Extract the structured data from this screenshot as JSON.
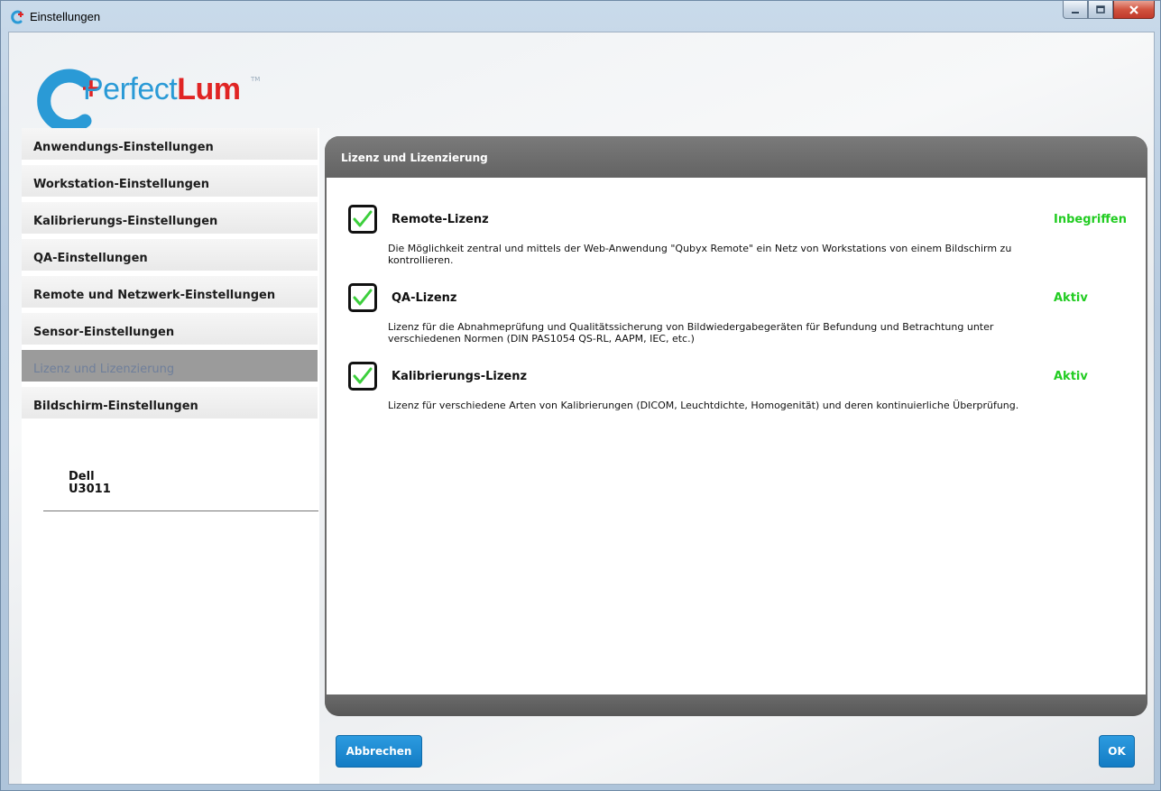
{
  "window": {
    "title": "Einstellungen"
  },
  "logo": {
    "name_prefix": "Perfect",
    "name_suffix": "Lum",
    "tm": "TM"
  },
  "sidebar": {
    "items": [
      {
        "label": "Anwendungs-Einstellungen",
        "active": false
      },
      {
        "label": "Workstation-Einstellungen",
        "active": false
      },
      {
        "label": "Kalibrierungs-Einstellungen",
        "active": false
      },
      {
        "label": "QA-Einstellungen",
        "active": false
      },
      {
        "label": "Remote und Netzwerk-Einstellungen",
        "active": false
      },
      {
        "label": "Sensor-Einstellungen",
        "active": false
      },
      {
        "label": "Lizenz und Lizenzierung",
        "active": true
      },
      {
        "label": "Bildschirm-Einstellungen",
        "active": false
      }
    ],
    "monitor": {
      "vendor": "Dell",
      "model": "U3011"
    }
  },
  "panel": {
    "title": "Lizenz und Lizenzierung",
    "licenses": [
      {
        "name": "Remote-Lizenz",
        "status": "Inbegriffen",
        "checked": true,
        "description": "Die Möglichkeit zentral und mittels der Web-Anwendung \"Qubyx Remote\" ein Netz von Workstations von einem Bildschirm zu kontrollieren."
      },
      {
        "name": "QA-Lizenz",
        "status": "Aktiv",
        "checked": true,
        "description": "Lizenz für die Abnahmeprüfung und Qualitätssicherung von Bildwiedergabegeräten für Befundung und Betrachtung unter verschiedenen Normen (DIN PAS1054 QS-RL, AAPM, IEC, etc.)"
      },
      {
        "name": "Kalibrierungs-Lizenz",
        "status": "Aktiv",
        "checked": true,
        "description": "Lizenz für verschiedene Arten von Kalibrierungen (DICOM, Leuchtdichte, Homogenität) und deren kontinuierliche Überprüfung."
      }
    ]
  },
  "buttons": {
    "cancel": "Abbrechen",
    "ok": "OK"
  },
  "colors": {
    "accent": "#1f8fd6",
    "status_green": "#22cc22",
    "panel_header": "#6c6c6c",
    "active_nav": "#9b9b9b",
    "logo_blue": "#2a9ad6",
    "logo_red": "#e02424"
  },
  "icons": {
    "app": "perfectlum-icon",
    "check": "checkmark-icon"
  }
}
